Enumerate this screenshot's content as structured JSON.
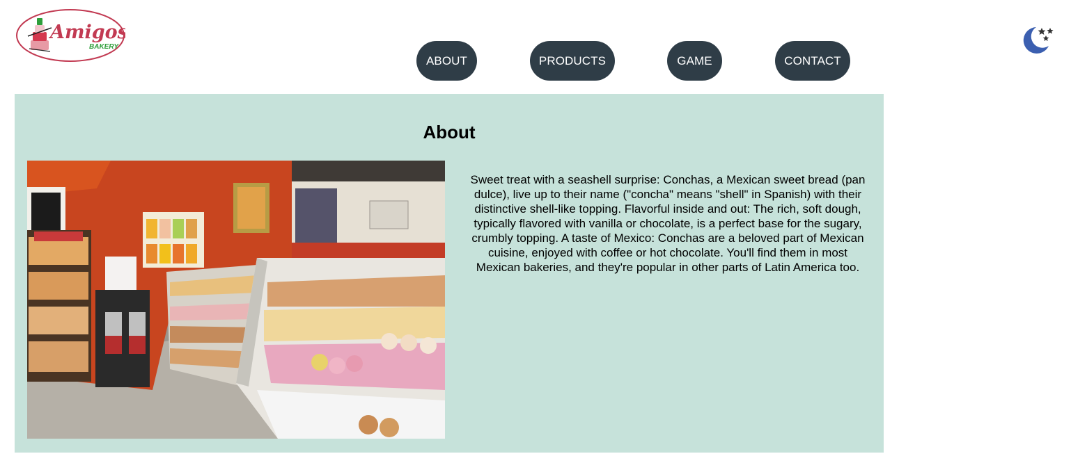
{
  "header": {
    "logo": {
      "brand_text": "Amigos",
      "sub_text": "BAKERY",
      "colors": {
        "outline": "#c23a52",
        "accent": "#2e9e3a"
      }
    },
    "nav": [
      {
        "label": "ABOUT"
      },
      {
        "label": "PRODUCTS"
      },
      {
        "label": "GAME"
      },
      {
        "label": "CONTACT"
      }
    ],
    "theme_toggle": {
      "icon": "moon-stars-icon",
      "color": "#3b5fb0"
    }
  },
  "about": {
    "title": "About",
    "image": {
      "subject": "bakery-interior-display-case"
    },
    "body": "Sweet treat with a seashell surprise: Conchas, a Mexican sweet bread (pan dulce), live up to their name (\"concha\" means \"shell\" in Spanish) with their distinctive shell-like topping. Flavorful inside and out: The rich, soft dough, typically flavored with vanilla or chocolate, is a perfect base for the sugary, crumbly topping. A taste of Mexico: Conchas are a beloved part of Mexican cuisine, enjoyed with coffee or hot chocolate. You'll find them in most Mexican bakeries, and they're popular in other parts of Latin America too."
  },
  "colors": {
    "nav_bg": "#2f3d47",
    "section_bg": "#c6e2da",
    "page_bg": "#ffffff"
  }
}
